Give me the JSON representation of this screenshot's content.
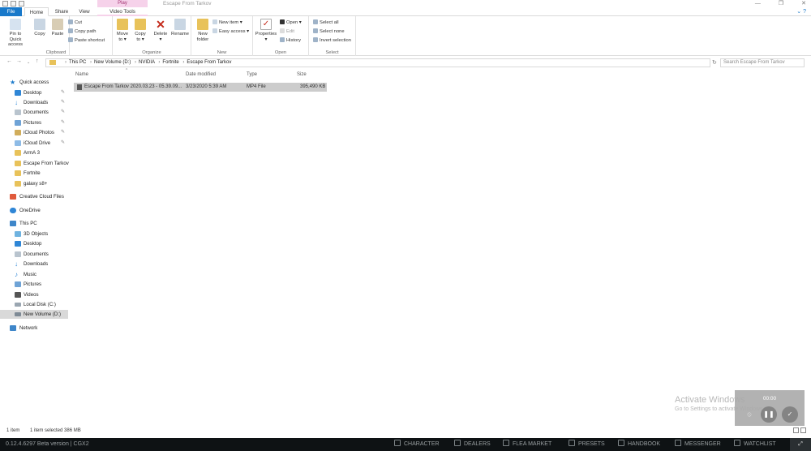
{
  "window": {
    "title": "Escape From Tarkov",
    "context_tab": "Play",
    "controls": [
      "—",
      "❐",
      "✕"
    ]
  },
  "tabs": [
    "File",
    "Home",
    "Share",
    "View",
    "Video Tools"
  ],
  "ribbon": {
    "clipboard": {
      "label": "Clipboard",
      "pin_label_1": "Pin to Quick",
      "pin_label_2": "access",
      "copy": "Copy",
      "paste": "Paste",
      "cut": "Cut",
      "copy_path": "Copy path",
      "paste_shortcut": "Paste shortcut"
    },
    "organize": {
      "label": "Organize",
      "move_to_1": "Move",
      "move_to_2": "to ▾",
      "copy_to_1": "Copy",
      "copy_to_2": "to ▾",
      "delete_1": "Delete",
      "delete_2": "▾",
      "rename": "Rename"
    },
    "new": {
      "label": "New",
      "new_folder_1": "New",
      "new_folder_2": "folder",
      "new_item": "New item ▾",
      "easy_access": "Easy access ▾"
    },
    "open": {
      "label": "Open",
      "properties": "Properties",
      "properties_2": "▾",
      "open": "Open ▾",
      "edit": "Edit",
      "history": "History"
    },
    "select": {
      "label": "Select",
      "select_all": "Select all",
      "select_none": "Select none",
      "invert": "Invert selection"
    }
  },
  "address": {
    "crumbs": [
      "This PC",
      "New Volume (D:)",
      "NVIDIA",
      "Fortnite",
      "Escape From Tarkov"
    ],
    "search_placeholder": "Search Escape From Tarkov"
  },
  "nav": {
    "quick_access": "Quick access",
    "desktop": "Desktop",
    "downloads": "Downloads",
    "documents": "Documents",
    "pictures": "Pictures",
    "icloud_photos": "iCloud Photos",
    "icloud_drive": "iCloud Drive",
    "arma": "ArmA 3",
    "eft": "Escape From Tarkov",
    "fortnite": "Fortnite",
    "galaxy": "galaxy s8+",
    "cc_files": "Creative Cloud Files",
    "onedrive": "OneDrive",
    "this_pc": "This PC",
    "objects3d": "3D Objects",
    "pc_desktop": "Desktop",
    "pc_documents": "Documents",
    "pc_downloads": "Downloads",
    "music": "Music",
    "pc_pictures": "Pictures",
    "videos": "Videos",
    "local_disk": "Local Disk (C:)",
    "new_volume": "New Volume (D:)",
    "network": "Network"
  },
  "columns": {
    "name": "Name",
    "date": "Date modified",
    "type": "Type",
    "size": "Size"
  },
  "files": [
    {
      "name": "Escape From Tarkov 2020.03.23 - 05.39.09...",
      "date": "3/23/2020 5:39 AM",
      "type": "MP4 File",
      "size": "395,490 KB"
    }
  ],
  "status": {
    "items": "1 item",
    "selected": "1 item selected  386 MB"
  },
  "activate": {
    "line1": "Activate Windows",
    "line2": "Go to Settings to activate Windows."
  },
  "video": {
    "time": "00:00"
  },
  "gamebar": {
    "version": "0.12.4.6297 Beta version | CGX2",
    "character": "CHARACTER",
    "dealers": "DEALERS",
    "flea": "FLEA MARKET",
    "presets": "PRESETS",
    "handbook": "HANDBOOK",
    "messenger": "MESSENGER",
    "watchlist": "WATCHLIST"
  },
  "colors": {
    "accent": "#1979ca",
    "context": "#f6d2ea",
    "folder": "#e8c25a",
    "selection": "#cccccc"
  }
}
